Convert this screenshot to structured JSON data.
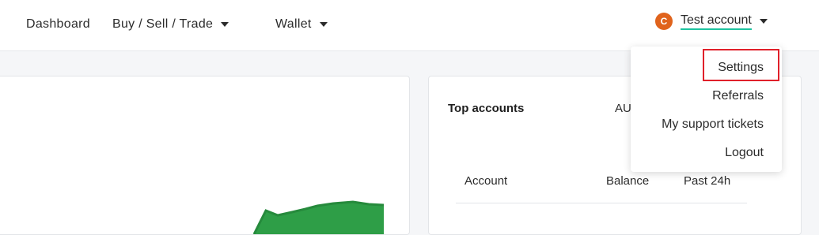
{
  "nav": {
    "dashboard": "Dashboard",
    "buy_sell_trade": "Buy / Sell / Trade",
    "wallet": "Wallet"
  },
  "account": {
    "avatar_glyph": "C",
    "label": "Test account"
  },
  "dropdown": {
    "items": [
      "Settings",
      "Referrals",
      "My support tickets",
      "Logout"
    ]
  },
  "top_accounts": {
    "title": "Top accounts",
    "currency_partial": "AU",
    "columns": [
      "Account",
      "Balance",
      "Past 24h"
    ]
  },
  "colors": {
    "chart_fill": "#2e9e47",
    "accent_underline": "#1ec3a0",
    "highlight": "#e0202a",
    "avatar": "#e0631c"
  },
  "icons": {
    "nav_dropdown": "caret-down-icon",
    "avatar": "currency-logo-icon"
  }
}
